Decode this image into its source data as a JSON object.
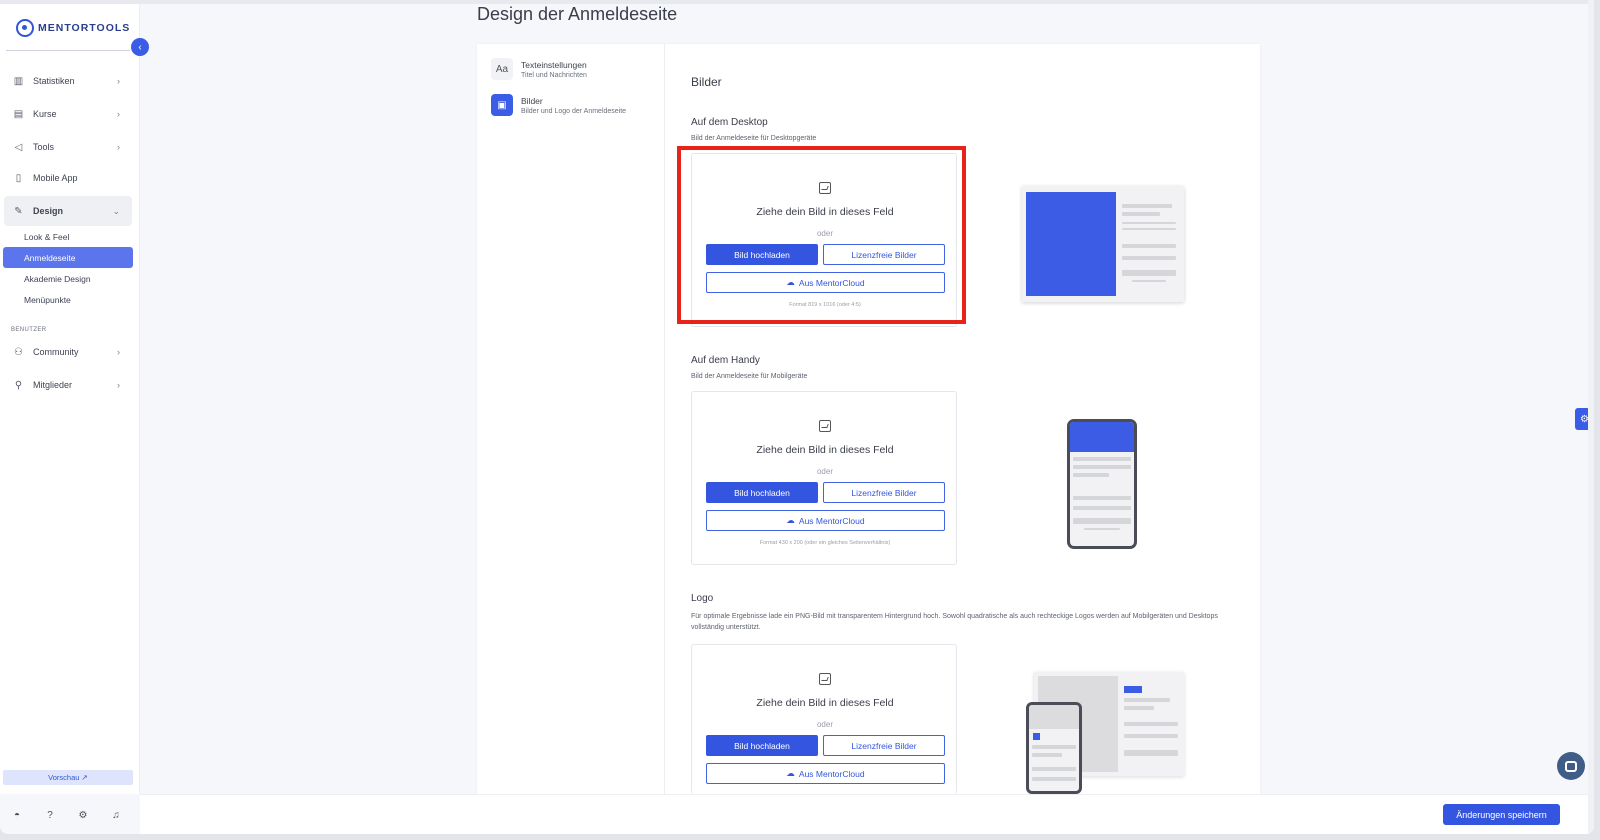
{
  "app": {
    "logo_text": "MENTORTOOLS"
  },
  "sidebar": {
    "items": [
      {
        "label": "Statistiken",
        "icon": "bar-chart-icon"
      },
      {
        "label": "Kurse",
        "icon": "book-icon"
      },
      {
        "label": "Tools",
        "icon": "megaphone-icon"
      },
      {
        "label": "Mobile App",
        "icon": "phone-icon"
      },
      {
        "label": "Design",
        "icon": "pencil-icon"
      }
    ],
    "design_sub": [
      "Look & Feel",
      "Anmeldeseite",
      "Akademie Design",
      "Menüpunkte"
    ],
    "section_label": "BENUTZER",
    "user_items": [
      {
        "label": "Community",
        "icon": "users-icon"
      },
      {
        "label": "Mitglieder",
        "icon": "user-icon"
      }
    ],
    "preview_label": "Vorschau ↗"
  },
  "page": {
    "title": "Design der Anmeldeseite"
  },
  "left_menu": [
    {
      "title": "Texteinstellungen",
      "sub": "Titel und Nachrichten",
      "icon": "text-icon"
    },
    {
      "title": "Bilder",
      "sub": "Bilder und Logo der Anmeldeseite",
      "icon": "image-icon"
    }
  ],
  "content": {
    "heading": "Bilder",
    "desktop": {
      "title": "Auf dem Desktop",
      "sub": "Bild der Anmeldeseite für Desktopgeräte",
      "format": "Format 819 x 1016 (oder 4:5)"
    },
    "mobile": {
      "title": "Auf dem Handy",
      "sub": "Bild der Anmeldeseite für Mobilgeräte",
      "format": "Format 430 x 200 (oder ein gleiches Seitenverhältnis)"
    },
    "logo": {
      "title": "Logo",
      "desc": "Für optimale Ergebnisse lade ein PNG-Bild mit transparentem Hintergrund hoch. Sowohl quadratische als auch rechteckige Logos werden auf Mobilgeräten und Desktops vollständig unterstützt."
    },
    "dropzone": {
      "text": "Ziehe dein Bild in dieses Feld",
      "or": "oder",
      "upload": "Bild hochladen",
      "license_free": "Lizenzfreie Bilder",
      "cloud": "Aus MentorCloud"
    }
  },
  "footer": {
    "save": "Änderungen speichern"
  },
  "colors": {
    "accent": "#3355e0",
    "highlight": "#e8231a"
  }
}
